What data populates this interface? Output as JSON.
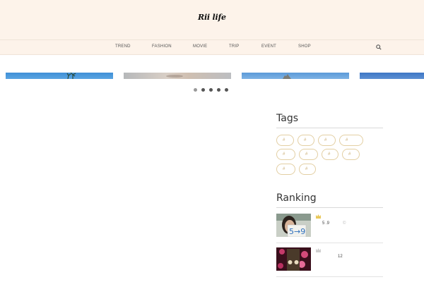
{
  "header": {
    "logo_text": "Rii life"
  },
  "nav": {
    "items": [
      {
        "label": "TREND"
      },
      {
        "label": "FASHION"
      },
      {
        "label": "MOVIE"
      },
      {
        "label": "TRIP"
      },
      {
        "label": "EVENT"
      },
      {
        "label": "SHOP"
      }
    ],
    "search_icon": "search-icon"
  },
  "slider": {
    "slide_count": 4,
    "dots": [
      {
        "active": true
      },
      {
        "active": false
      },
      {
        "active": false
      },
      {
        "active": false
      },
      {
        "active": false
      }
    ]
  },
  "sidebar": {
    "tags_title": "Tags",
    "tags": [
      {
        "label": "#"
      },
      {
        "label": "#"
      },
      {
        "label": "#"
      },
      {
        "label": "#"
      },
      {
        "label": "#"
      },
      {
        "label": "#"
      },
      {
        "label": "#"
      },
      {
        "label": "#"
      },
      {
        "label": "#"
      },
      {
        "label": "#"
      }
    ],
    "ranking_title": "Ranking",
    "ranking": [
      {
        "thumb_text": "5→9",
        "crown": "gold",
        "text_a": "5 .9",
        "text_b": "©"
      },
      {
        "crown": "silver",
        "text_a": "12"
      }
    ]
  },
  "colors": {
    "header_bg": "#fdf3ea",
    "tag_border": "#e3cfa3",
    "tag_text": "#c9ab70"
  }
}
